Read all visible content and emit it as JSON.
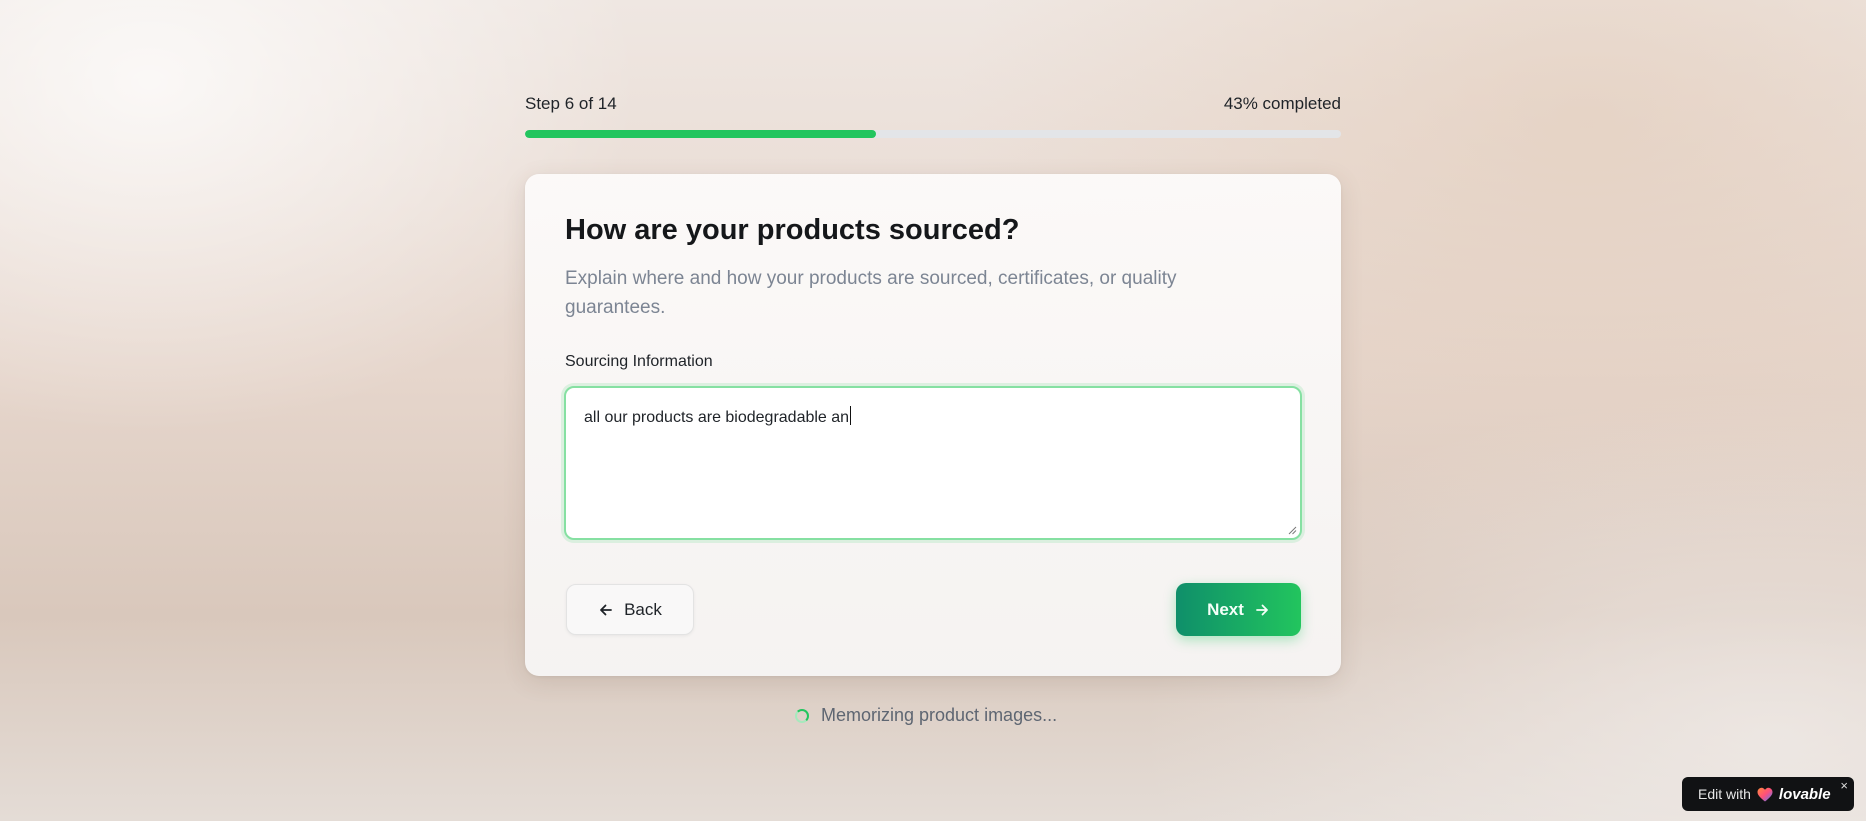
{
  "progress": {
    "step_label": "Step 6 of 14",
    "completed_label": "43% completed",
    "fraction": 0.43
  },
  "card": {
    "title": "How are your products sourced?",
    "subtitle": "Explain where and how your products are sourced, certificates, or quality guarantees.",
    "field_label": "Sourcing Information",
    "field_value": "all our products are biodegradable an"
  },
  "buttons": {
    "back_label": "Back",
    "next_label": "Next"
  },
  "status": {
    "text": "Memorizing product images..."
  },
  "badge": {
    "prefix": "Edit with",
    "brand": "lovable",
    "close": "×"
  },
  "colors": {
    "accent": "#22c55e",
    "accent_dark": "#0f8f6a",
    "track": "#e3e5e8"
  },
  "icons": {
    "back": "arrow-left-icon",
    "next": "arrow-right-icon",
    "status": "spinner-icon",
    "brand": "heart-logo-icon",
    "resize": "resize-handle-icon"
  }
}
